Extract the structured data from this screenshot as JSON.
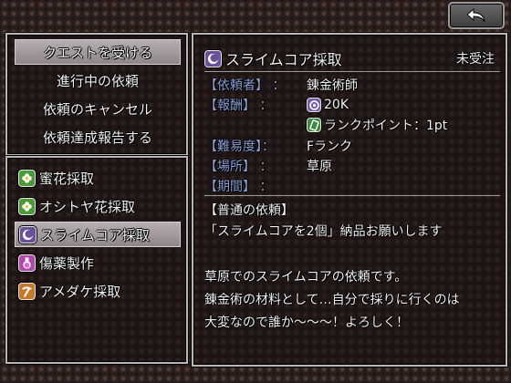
{
  "back_button": {
    "icon": "back-arrow-icon"
  },
  "menu": {
    "items": [
      {
        "label": "クエストを受ける",
        "selected": true
      },
      {
        "label": "進行中の依頼",
        "selected": false
      },
      {
        "label": "依頼のキャンセル",
        "selected": false
      },
      {
        "label": "依頼達成報告する",
        "selected": false
      }
    ]
  },
  "quest_list": {
    "items": [
      {
        "label": "蜜花採取",
        "icon": "flower-icon",
        "icon_color": "#4e9a3a",
        "selected": false
      },
      {
        "label": "オシトヤ花採取",
        "icon": "flower-icon",
        "icon_color": "#4e9a3a",
        "selected": false
      },
      {
        "label": "スライムコア採取",
        "icon": "slime-core-icon",
        "icon_color": "#7b5ca8",
        "selected": true
      },
      {
        "label": "傷薬製作",
        "icon": "potion-icon",
        "icon_color": "#b04aa8",
        "selected": false
      },
      {
        "label": "アメダケ採取",
        "icon": "pickaxe-icon",
        "icon_color": "#c8782a",
        "selected": false
      }
    ]
  },
  "detail": {
    "title": "スライムコア採取",
    "title_icon": "slime-core-icon",
    "status": "未受注",
    "client_label": "【依頼者】 ：",
    "client": "錬金術師",
    "reward_label": "【報酬】 ：",
    "reward_money": "20K",
    "reward_money_icon": "coin-icon",
    "reward_rank": "ランクポイント：1pt",
    "reward_rank_icon": "rank-card-icon",
    "difficulty_label": "【難易度】：",
    "difficulty": "Fランク",
    "location_label": "【場所】 ：",
    "location": "草原",
    "period_label": "【期間】 ：",
    "period": "",
    "section_title": "【普通の依頼】",
    "requirement": "「スライムコアを2個」納品お願いします",
    "description": [
      "草原でのスライムコアの依頼です。",
      "錬金術の材料として…自分で採りに行くのは",
      "大変なので誰か～～～！よろしく！"
    ]
  },
  "colors": {
    "label_blue": "#8a9fd8",
    "panel_border": "#b8b8b8",
    "selected_bg": "#a79fa1"
  }
}
